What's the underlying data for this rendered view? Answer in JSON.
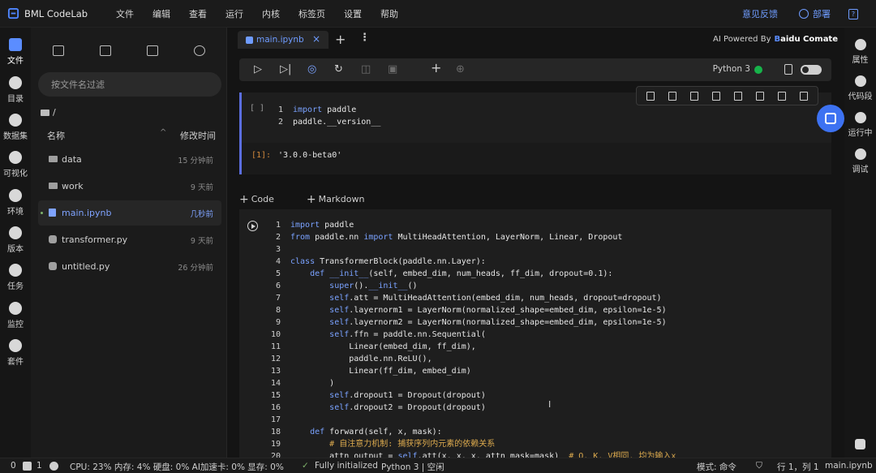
{
  "app": {
    "title": "BML CodeLab"
  },
  "menu": [
    "文件",
    "编辑",
    "查看",
    "运行",
    "内核",
    "标签页",
    "设置",
    "帮助"
  ],
  "header_right": {
    "feedback": "意见反馈",
    "deploy": "部署"
  },
  "activity_bar": [
    {
      "label": "文件",
      "icon": "folder-icon",
      "active": true
    },
    {
      "label": "目录",
      "icon": "list-icon"
    },
    {
      "label": "数据集",
      "icon": "dataset-icon"
    },
    {
      "label": "可视化",
      "icon": "chart-icon"
    },
    {
      "label": "环境",
      "icon": "environment-icon"
    },
    {
      "label": "版本",
      "icon": "version-icon"
    },
    {
      "label": "任务",
      "icon": "task-icon"
    },
    {
      "label": "监控",
      "icon": "monitor-icon"
    },
    {
      "label": "套件",
      "icon": "suite-icon"
    }
  ],
  "file_panel": {
    "filter_placeholder": "按文件名过滤",
    "path": "/",
    "col_name": "名称",
    "col_modified": "修改时间",
    "sort_indicator": "^",
    "files": [
      {
        "name": "data",
        "type": "folder",
        "modified": "15 分钟前"
      },
      {
        "name": "work",
        "type": "folder",
        "modified": "9 天前"
      },
      {
        "name": "main.ipynb",
        "type": "notebook",
        "modified": "几秒前",
        "selected": true
      },
      {
        "name": "transformer.py",
        "type": "python",
        "modified": "9 天前"
      },
      {
        "name": "untitled.py",
        "type": "python",
        "modified": "26 分钟前"
      }
    ]
  },
  "tabs": [
    {
      "label": "main.ipynb",
      "close": "×"
    }
  ],
  "tab_actions": {
    "add": "+",
    "more": "⋮"
  },
  "ai": {
    "prefix": "AI Powered By",
    "brand_b": "B",
    "brand_rest": "aidu Comate"
  },
  "toolbar": {
    "kernel_name": "Python 3",
    "kernel_status_color": "#17b34a",
    "buttons": [
      "run-icon",
      "run-all-icon",
      "restart-run-icon",
      "restart-icon",
      "interrupt-icon",
      "save-icon",
      "add-cell-icon",
      "target-icon"
    ]
  },
  "notebook": {
    "add_code": "Code",
    "add_markdown": "Markdown",
    "cell1": {
      "prompt": "[ ]",
      "lines": [
        [
          {
            "c": "kw",
            "t": "import"
          },
          {
            "c": "tx2",
            "t": " paddle"
          }
        ],
        [
          {
            "c": "tx2",
            "t": "paddle.__version__"
          }
        ]
      ],
      "output_prompt": "[1]:",
      "output": "'3.0.0-beta0'"
    },
    "cell2": {
      "lines": [
        [
          {
            "c": "kw",
            "t": "import"
          },
          {
            "c": "tx2",
            "t": " paddle"
          }
        ],
        [
          {
            "c": "kw",
            "t": "from"
          },
          {
            "c": "tx2",
            "t": " paddle.nn "
          },
          {
            "c": "kw",
            "t": "import"
          },
          {
            "c": "tx2",
            "t": " MultiHeadAttention, LayerNorm, Linear, Dropout"
          }
        ],
        [],
        [
          {
            "c": "kw",
            "t": "class"
          },
          {
            "c": "tx2",
            "t": " TransformerBlock(paddle.nn.Layer):"
          }
        ],
        [
          {
            "c": "tx2",
            "t": "    "
          },
          {
            "c": "kw",
            "t": "def"
          },
          {
            "c": "tx2",
            "t": " "
          },
          {
            "c": "sf",
            "t": "__init__"
          },
          {
            "c": "tx2",
            "t": "("
          },
          {
            "c": "tx2",
            "t": "self, embed_dim, num_heads, ff_dim, dropout="
          },
          {
            "c": "num",
            "t": "0.1"
          },
          {
            "c": "tx2",
            "t": "):"
          }
        ],
        [
          {
            "c": "tx2",
            "t": "        "
          },
          {
            "c": "sf",
            "t": "super"
          },
          {
            "c": "tx2",
            "t": "()."
          },
          {
            "c": "sf",
            "t": "__init__"
          },
          {
            "c": "tx2",
            "t": "()"
          }
        ],
        [
          {
            "c": "tx2",
            "t": "        "
          },
          {
            "c": "sf",
            "t": "self"
          },
          {
            "c": "tx2",
            "t": ".att = MultiHeadAttention(embed_dim, num_heads, dropout=dropout)"
          }
        ],
        [
          {
            "c": "tx2",
            "t": "        "
          },
          {
            "c": "sf",
            "t": "self"
          },
          {
            "c": "tx2",
            "t": ".layernorm1 = LayerNorm(normalized_shape=embed_dim, epsilon="
          },
          {
            "c": "num",
            "t": "1e-5"
          },
          {
            "c": "tx2",
            "t": ")"
          }
        ],
        [
          {
            "c": "tx2",
            "t": "        "
          },
          {
            "c": "sf",
            "t": "self"
          },
          {
            "c": "tx2",
            "t": ".layernorm2 = LayerNorm(normalized_shape=embed_dim, epsilon="
          },
          {
            "c": "num",
            "t": "1e-5"
          },
          {
            "c": "tx2",
            "t": ")"
          }
        ],
        [
          {
            "c": "tx2",
            "t": "        "
          },
          {
            "c": "sf",
            "t": "self"
          },
          {
            "c": "tx2",
            "t": ".ffn = paddle.nn.Sequential("
          }
        ],
        [
          {
            "c": "tx2",
            "t": "            Linear(embed_dim, ff_dim),"
          }
        ],
        [
          {
            "c": "tx2",
            "t": "            paddle.nn.ReLU(),"
          }
        ],
        [
          {
            "c": "tx2",
            "t": "            Linear(ff_dim, embed_dim)"
          }
        ],
        [
          {
            "c": "tx2",
            "t": "        )"
          }
        ],
        [
          {
            "c": "tx2",
            "t": "        "
          },
          {
            "c": "sf",
            "t": "self"
          },
          {
            "c": "tx2",
            "t": ".dropout1 = Dropout(dropout)"
          }
        ],
        [
          {
            "c": "tx2",
            "t": "        "
          },
          {
            "c": "sf",
            "t": "self"
          },
          {
            "c": "tx2",
            "t": ".dropout2 = Dropout(dropout)"
          }
        ],
        [],
        [
          {
            "c": "tx2",
            "t": "    "
          },
          {
            "c": "kw",
            "t": "def"
          },
          {
            "c": "tx2",
            "t": " forward(self, x, mask):"
          }
        ],
        [
          {
            "c": "tx2",
            "t": "        "
          },
          {
            "c": "cm",
            "t": "# 自注意力机制: 捕获序列内元素的依赖关系"
          }
        ],
        [
          {
            "c": "tx2",
            "t": "        attn_output = "
          },
          {
            "c": "sf",
            "t": "self"
          },
          {
            "c": "tx2",
            "t": ".att(x, x, x, attn_mask=mask)  "
          },
          {
            "c": "cm",
            "t": "# Q, K, V相同, 均为输入x"
          }
        ]
      ]
    }
  },
  "right_bar": [
    {
      "label": "属性",
      "icon": "gear-icon"
    },
    {
      "label": "代码段",
      "icon": "snippet-icon"
    },
    {
      "label": "运行中",
      "icon": "running-icon"
    },
    {
      "label": "调试",
      "icon": "debug-icon"
    }
  ],
  "status": {
    "count": "0",
    "terminals": "1",
    "resources": "CPU: 23% 内存: 4% 硬盘: 0% AI加速卡: 0% 显存: 0%",
    "initialized": "Fully initialized",
    "kernel": "Python 3 | 空闲",
    "mode": "模式: 命令",
    "position": "行 1，列 1",
    "file": "main.ipynb"
  }
}
